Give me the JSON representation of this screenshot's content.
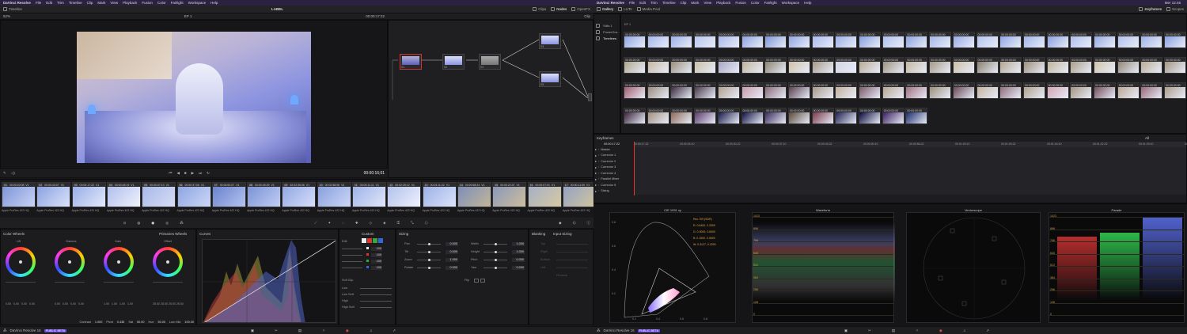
{
  "left": {
    "menubar": {
      "brand": "DaVinci Resolve",
      "items": [
        "File",
        "Edit",
        "Trim",
        "Timeline",
        "Clip",
        "Mark",
        "View",
        "Playback",
        "Fusion",
        "Color",
        "Fairlight",
        "Workspace",
        "Help"
      ],
      "title": "LABEL"
    },
    "toolbar": {
      "zoom": "52%",
      "timeline": "Timeline",
      "clip_name": "EP 1",
      "timecode": "00:00:17:22",
      "clips": "Clips",
      "nodes": "Nodes",
      "openfx": "OpenFX",
      "clip": "Clip"
    },
    "viewer": {
      "timecode": "00:00:16;01"
    },
    "clips": [
      {
        "n": "01",
        "tc": "00:00:20:08",
        "v": "V1",
        "codec": "Apple ProRes 422 HQ",
        "c1": "#7f95d8",
        "c2": "#c8d4f4"
      },
      {
        "n": "02",
        "tc": "00:00:43:07",
        "v": "V1",
        "codec": "Apple ProRes 422 HQ",
        "c1": "#8ba2e0",
        "c2": "#dbe3fb"
      },
      {
        "n": "03",
        "tc": "00:00:17:22",
        "v": "V1",
        "codec": "Apple ProRes 422 HQ",
        "c1": "#9aaee6",
        "c2": "#e3eafc"
      },
      {
        "n": "04",
        "tc": "00:00:48:19",
        "v": "V1",
        "codec": "Apple ProRes 422 HQ",
        "c1": "#b0bfec",
        "c2": "#f0f3fd"
      },
      {
        "n": "05",
        "tc": "00:00:07:13",
        "v": "V1",
        "codec": "Apple ProRes 422 HQ",
        "c1": "#a8b8e8",
        "c2": "#d6def6"
      },
      {
        "n": "06",
        "tc": "00:00:37:06",
        "v": "V1",
        "codec": "Apple ProRes 422 HQ",
        "c1": "#8ea5e4",
        "c2": "#cdd8f6"
      },
      {
        "n": "07",
        "tc": "00:00:52:07",
        "v": "V1",
        "codec": "Apple ProRes 422 HQ",
        "c1": "#6b83cf",
        "c2": "#b5c3ef"
      },
      {
        "n": "08",
        "tc": "00:00:49:29",
        "v": "V1",
        "codec": "Apple ProRes 422 HQ",
        "c1": "#7b92d6",
        "c2": "#c1cef3"
      },
      {
        "n": "09",
        "tc": "00:02:35:06",
        "v": "V1",
        "codec": "Apple ProRes 422 HQ",
        "c1": "#93a7e3",
        "c2": "#d6dffa"
      },
      {
        "n": "10",
        "tc": "00:02:58:06",
        "v": "V1",
        "codec": "Apple ProRes 422 HQ",
        "c1": "#8aa0dd",
        "c2": "#ccd7f7"
      },
      {
        "n": "11",
        "tc": "00:00:11:11",
        "v": "V1",
        "codec": "Apple ProRes 422 HQ",
        "c1": "#a0b3e7",
        "c2": "#e0e7fb"
      },
      {
        "n": "12",
        "tc": "00:02:25:12",
        "v": "V1",
        "codec": "Apple ProRes 422 HQ",
        "c1": "#b3c1ec",
        "c2": "#eef2fd"
      },
      {
        "n": "13",
        "tc": "00:03:11:22",
        "v": "V1",
        "codec": "Apple ProRes 422 HQ",
        "c1": "#9eb1e6",
        "c2": "#dae3fa"
      },
      {
        "n": "14",
        "tc": "00:00:58:24",
        "v": "V1",
        "codec": "Apple ProRes 422 HQ",
        "c1": "#7d8fb8",
        "c2": "#c2b69a"
      },
      {
        "n": "15",
        "tc": "00:00:22:07",
        "v": "V1",
        "codec": "Apple ProRes 422 HQ",
        "c1": "#8a98b9",
        "c2": "#cdbf9e"
      },
      {
        "n": "16",
        "tc": "00:00:07:01",
        "v": "V1",
        "codec": "Apple ProRes 422 HQ",
        "c1": "#a6b0c5",
        "c2": "#d7c9a4"
      },
      {
        "n": "17",
        "tc": "00:00:11:09",
        "v": "V1",
        "codec": "Apple ProRes 422 HQ",
        "c1": "#95a3c3",
        "c2": "#d2c59f"
      }
    ],
    "color_wheels": {
      "title": "Color Wheels",
      "mode": "Primaries Wheels",
      "wheels": [
        {
          "name": "Lift",
          "vals": [
            "0.00",
            "0.00",
            "0.00",
            "0.00"
          ]
        },
        {
          "name": "Gamma",
          "vals": [
            "0.00",
            "0.00",
            "0.00",
            "0.00"
          ]
        },
        {
          "name": "Gain",
          "vals": [
            "1.00",
            "1.00",
            "1.00",
            "1.00"
          ]
        },
        {
          "name": "Offset",
          "vals": [
            "25.00",
            "25.00",
            "25.00",
            "25.00"
          ]
        }
      ],
      "footer": [
        {
          "k": "Contrast",
          "v": "1.000"
        },
        {
          "k": "Pivot",
          "v": "0.435"
        },
        {
          "k": "Sat",
          "v": "50.00"
        },
        {
          "k": "Hue",
          "v": "50.00"
        },
        {
          "k": "Lum Mix",
          "v": "100.00"
        }
      ]
    },
    "curves": {
      "title": "Curves",
      "custom": "Custom",
      "edit": "Edit",
      "values": [
        "100",
        "100",
        "100",
        "100"
      ],
      "soft_clip": "Soft Clip",
      "soft_rows": [
        "Low",
        "Low Soft",
        "High",
        "High Soft"
      ]
    },
    "sizing": {
      "title": "Sizing",
      "input": "Input Sizing",
      "blanking": "Blanking",
      "left": [
        {
          "k": "Pan",
          "v": "0.000"
        },
        {
          "k": "Tilt",
          "v": "0.000"
        },
        {
          "k": "Zoom",
          "v": "1.000"
        },
        {
          "k": "Rotate",
          "v": "0.000"
        }
      ],
      "right": [
        {
          "k": "Width",
          "v": "1.000"
        },
        {
          "k": "Height",
          "v": "1.000"
        },
        {
          "k": "Pitch",
          "v": "0.000"
        },
        {
          "k": "Yaw",
          "v": "0.000"
        }
      ],
      "flip": "Flip",
      "blank_rows": [
        "Top",
        "Right",
        "Bottom",
        "Left",
        "Reverse"
      ]
    },
    "status": {
      "app": "DaVinci Resolve 16",
      "badge": "PUBLIC BETA"
    }
  },
  "right": {
    "menubar": {
      "brand": "DaVinci Resolve",
      "items": [
        "File",
        "Edit",
        "Trim",
        "Timeline",
        "Clip",
        "Mark",
        "View",
        "Playback",
        "Fusion",
        "Color",
        "Fairlight",
        "Workspace",
        "Help"
      ],
      "clock": "Mer 12:46"
    },
    "toolbar": {
      "gallery": "Gallery",
      "luts": "LUTs",
      "media_pool": "Media Pool",
      "keyframes": "Keyframes",
      "scopes": "Scopes"
    },
    "gallery": {
      "album": "Stills 1",
      "powergrade": "PowerGra...",
      "timelines": "Timelines",
      "dropdown": "EP 1",
      "tc": "00:00:00:00",
      "rows": [
        [
          "#8fa6e2",
          "#a6b8ea",
          "#9cb0e6",
          "#b8c6ef",
          "#aab9ea",
          "#8fa4e0",
          "#7e95d8",
          "#92a7e2",
          "#a9baec",
          "#9cb0e7",
          "#88a0de",
          "#b0c0ee",
          "#8da3e0",
          "#a4b5e8",
          "#98abe4",
          "#b5c4ef",
          "#93a8e3",
          "#a1b3e8",
          "#8ba1df",
          "#aebfec",
          "#97aae3",
          "#b2c1ed",
          "#9fb2e7",
          "#8ca2df"
        ],
        [
          "#b0a68e",
          "#c6b8a0",
          "#9a8f7c",
          "#c9bfa6",
          "#a8a6c2",
          "#bfb29c",
          "#8c8270",
          "#cfc1a8",
          "#a69a86",
          "#d2d4e0",
          "#b8ab95",
          "#9e9380",
          "#c4b7a0",
          "#a59985",
          "#cbbea6",
          "#8a7f6e",
          "#b4a791",
          "#9c8f7b",
          "#c0b39c",
          "#aa9e8a",
          "#d0c3ab",
          "#928675",
          "#b9ac96",
          "#a39784"
        ],
        [
          "#a05e6e",
          "#9a8c7e",
          "#3a2a3c",
          "#4a3a48",
          "#b0a090",
          "#c89aa8",
          "#886a78",
          "#5a4050",
          "#a89888",
          "#c2b09c",
          "#7a5a68",
          "#b8a592",
          "#a07080",
          "#9e8e7c",
          "#6a4a58",
          "#c4b4a0",
          "#8e6e7c",
          "#b0a08e",
          "#d2a4b2",
          "#a49482",
          "#724e5c",
          "#bca896",
          "#986876",
          "#ac9c8a"
        ],
        [
          "#3a2238",
          "#a4907e",
          "#8c6a5a",
          "#5a3a6a",
          "#1a1a4a",
          "#101040",
          "#3a2a5a",
          "#5a4a3a",
          "#7a3a4a",
          "#202050",
          "#0a0a3a",
          "#3a2060",
          "#1a2a6a"
        ]
      ]
    },
    "keyframes": {
      "title": "Keyframes",
      "all": "All",
      "tc": "00:00:17:22",
      "ruler": [
        "00:00:17:22",
        "00:00:24:10",
        "00:00:30:22",
        "00:00:37:10",
        "00:00:43:22",
        "00:00:50:10",
        "00:00:56:22",
        "00:01:03:10",
        "00:01:09:22",
        "00:01:16:10",
        "00:01:22:22",
        "00:01:29:10",
        "00:01:35:22"
      ],
      "rows": [
        "Master",
        "Corrector 1",
        "Corrector 2",
        "Corrector 3",
        "Corrector 4",
        "Parallel Mixer",
        "Corrector 5",
        "Sizing"
      ]
    },
    "scopes": {
      "cie": "CIE 1931 xy",
      "waveform": "Waveform",
      "vectorscope": "Vectorscope",
      "parade": "Parade",
      "cie_info": [
        "Rec.709 (SDR)",
        "R: 0.6400, 0.3300",
        "G: 0.3000, 0.6000",
        "B: 0.1500, 0.0600",
        "W: 0.3127, 0.3290"
      ],
      "axis": [
        "1023",
        "896",
        "768",
        "640",
        "512",
        "384",
        "256",
        "128",
        "0"
      ],
      "cie_y": [
        "0.8",
        "0.6",
        "0.4",
        "0.2"
      ],
      "cie_x": [
        "0.2",
        "0.4",
        "0.6",
        "0.8"
      ]
    },
    "status": {
      "app": "DaVinci Resolve 16",
      "badge": "PUBLIC BETA"
    }
  }
}
